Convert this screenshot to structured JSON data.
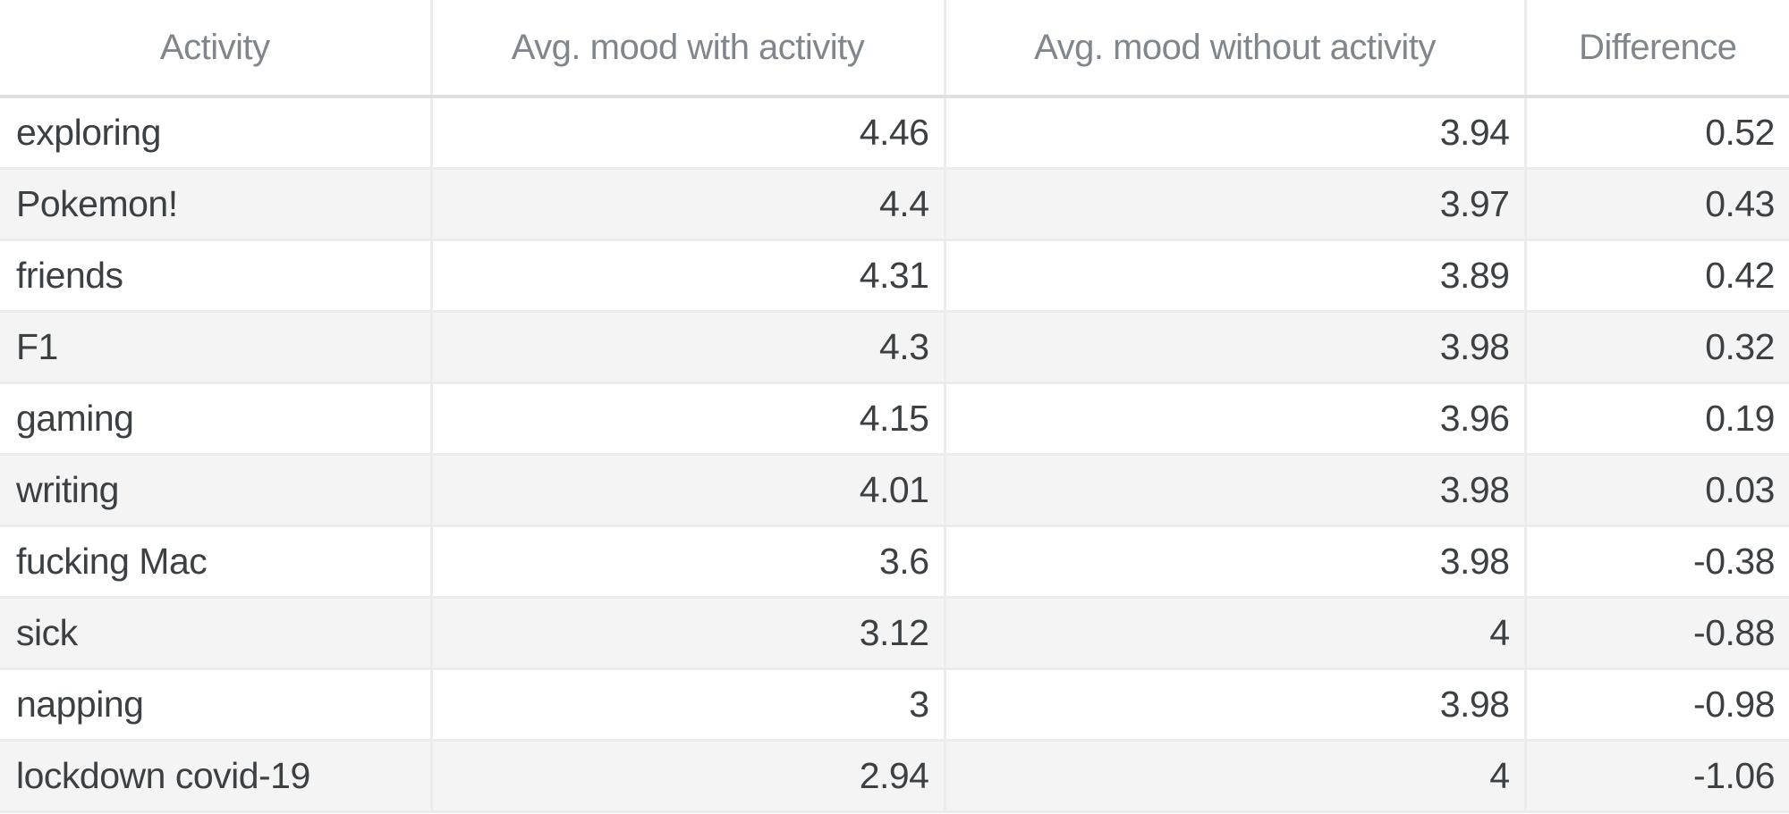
{
  "table": {
    "columns": [
      "Activity",
      "Avg. mood with activity",
      "Avg. mood without activity",
      "Difference"
    ],
    "rows": [
      [
        "exploring",
        "4.46",
        "3.94",
        "0.52"
      ],
      [
        "Pokemon!",
        "4.4",
        "3.97",
        "0.43"
      ],
      [
        "friends",
        "4.31",
        "3.89",
        "0.42"
      ],
      [
        "F1",
        "4.3",
        "3.98",
        "0.32"
      ],
      [
        "gaming",
        "4.15",
        "3.96",
        "0.19"
      ],
      [
        "writing",
        "4.01",
        "3.98",
        "0.03"
      ],
      [
        "fucking Mac",
        "3.6",
        "3.98",
        "-0.38"
      ],
      [
        "sick",
        "3.12",
        "4",
        "-0.88"
      ],
      [
        "napping",
        "3",
        "3.98",
        "-0.98"
      ],
      [
        "lockdown covid-19",
        "2.94",
        "4",
        "-1.06"
      ]
    ]
  },
  "colors": {
    "header_text": "#80868b",
    "cell_text": "#3c4043",
    "stripe": "#f4f4f4",
    "grid": "#ececec"
  }
}
